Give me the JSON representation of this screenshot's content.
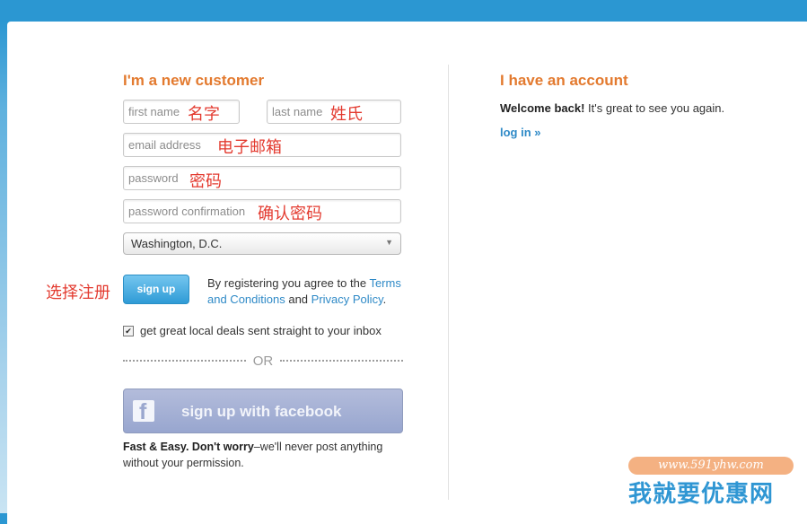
{
  "new_customer": {
    "heading": "I'm a new customer",
    "first_name_placeholder": "first name",
    "last_name_placeholder": "last name",
    "email_placeholder": "email address",
    "password_placeholder": "password",
    "password_confirm_placeholder": "password confirmation",
    "city_selected": "Washington, D.C.",
    "signup_label": "sign up",
    "terms_prefix": "By registering you agree to the ",
    "terms_link": "Terms and Conditions",
    "terms_and": " and ",
    "privacy_link": "Privacy Policy",
    "terms_suffix": ".",
    "deals_checked": true,
    "deals_label": "get great local deals sent straight to your inbox",
    "or_label": "OR",
    "facebook_label": "sign up with facebook",
    "fast_bold": "Fast & Easy. Don't worry",
    "fast_rest": "–we'll never post anything without your permission."
  },
  "annotations": {
    "first_name": "名字",
    "last_name": "姓氏",
    "email": "电子邮箱",
    "password": "密码",
    "password_confirm": "确认密码",
    "signup": "选择注册"
  },
  "account": {
    "heading": "I have an account",
    "welcome_bold": "Welcome back!",
    "welcome_rest": " It's great to see you again.",
    "login_label": "log in »"
  },
  "watermark": {
    "url": "www.591yhw.com",
    "name": "我就要优惠网"
  },
  "colors": {
    "heading_orange": "#e37a2f",
    "link_blue": "#2f8ac7",
    "annotation_red": "#e33a2f",
    "facebook_button": "#a6b2d6",
    "header_blue": "#2b97d2"
  }
}
